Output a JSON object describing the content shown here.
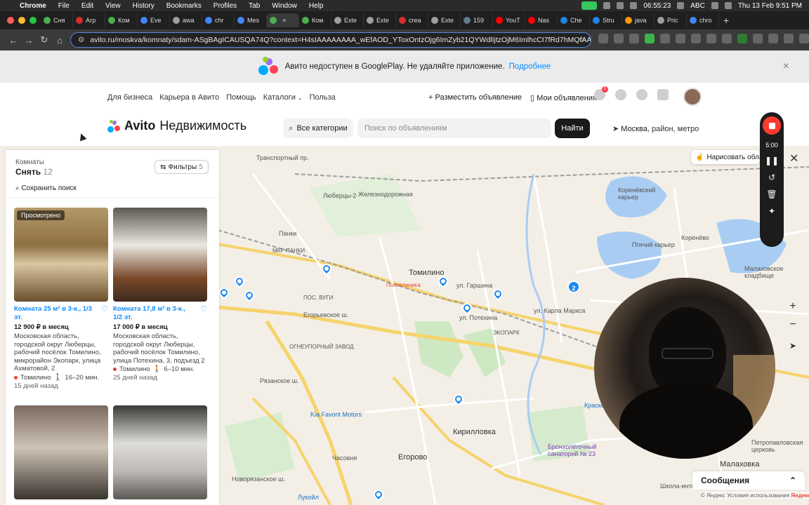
{
  "menubar": {
    "app": "Chrome",
    "items": [
      "File",
      "Edit",
      "View",
      "History",
      "Bookmarks",
      "Profiles",
      "Tab",
      "Window",
      "Help"
    ],
    "clock_timer": "06:55:23",
    "input_source": "ABC",
    "datetime": "Thu 13 Feb  9:51 PM"
  },
  "tabs": [
    {
      "label": "Сня",
      "color": "#4caf50"
    },
    {
      "label": "Агр",
      "color": "#d32f2f"
    },
    {
      "label": "Ком",
      "color": "#4caf50"
    },
    {
      "label": "Eve",
      "color": "#4285f4"
    },
    {
      "label": "awa",
      "color": "#9e9e9e"
    },
    {
      "label": "chr",
      "color": "#4285f4"
    },
    {
      "label": "Mes",
      "color": "#4285f4"
    },
    {
      "label": "",
      "color": "#4caf50",
      "active": true
    },
    {
      "label": "Ком",
      "color": "#4caf50"
    },
    {
      "label": "Exte",
      "color": "#9e9e9e"
    },
    {
      "label": "Exte",
      "color": "#9e9e9e"
    },
    {
      "label": "crea",
      "color": "#d32f2f"
    },
    {
      "label": "Exte",
      "color": "#9e9e9e"
    },
    {
      "label": "159",
      "color": "#607d8b"
    },
    {
      "label": "YouT",
      "color": "#ff0000"
    },
    {
      "label": "Nas",
      "color": "#ff0000"
    },
    {
      "label": "Che",
      "color": "#1e88e5"
    },
    {
      "label": "Stru",
      "color": "#1e88e5"
    },
    {
      "label": "java",
      "color": "#ff9800"
    },
    {
      "label": "Pric",
      "color": "#9e9e9e"
    },
    {
      "label": "chro",
      "color": "#4285f4"
    }
  ],
  "address": {
    "url": "avito.ru/moskva/komnaty/sdam-ASgBAgICAUSQA74Q?context=H4sIAAAAAAAA_wEfAOD_YToxOntzOjg6ImZyb21QYWdlIjtzOjM6ImlhcCI7fRd7hMQfAAAA&f=AS..."
  },
  "banner": {
    "text": "Авито недоступен в GooglePlay. Не удаляйте приложение.",
    "link": "Подробнее",
    "close": "×"
  },
  "topnav": {
    "links": [
      "Для бизнеса",
      "Карьера в Авито",
      "Помощь",
      "Каталоги",
      "Польза"
    ],
    "post_ad": "Разместить объявление",
    "my_ads": "Мои объявления",
    "fav_badge": "1"
  },
  "header": {
    "brand": "Avito",
    "section": "Недвижимость",
    "categories": "Все категории",
    "search_placeholder": "Поиск по объявлениям",
    "find": "Найти",
    "location": "Москва",
    "location_rest": ", район, метро"
  },
  "listing": {
    "crumb": "Комнаты",
    "title": "Снять",
    "count": "12",
    "filters": "Фильтры",
    "filters_count": "5",
    "save_search": "Сохранить поиск",
    "cards": [
      {
        "tag": "Просмотрено",
        "title": "Комната 25 м² в 3-к., 1/3 эт.",
        "price": "12 900 ₽ в месяц",
        "address": "Московская область, городской округ Люберцы, рабочий посёлок Томилино, микрорайон Экопарк, улица Ахматовой, 2",
        "metro": "Томилино",
        "walk": "16–20 мин.",
        "ago": "15 дней назад"
      },
      {
        "tag": "",
        "title": "Комната 17,8 м² в 3-к., 1/2 эт.",
        "price": "17 000 ₽ в месяц",
        "address": "Московская область, городской округ Люберцы, рабочий посёлок Томилино, улица Потехина, 3, подъезд 2",
        "metro": "Томилино",
        "walk": "6–10 мин.",
        "ago": "25 дней назад"
      }
    ]
  },
  "map": {
    "draw_area": "Нарисовать область",
    "messages": "Сообщения",
    "attribution": "© Яндекс Условия использования",
    "yandex": "Яндекс",
    "cluster_count": "2",
    "labels": [
      "Транспортный пр.",
      "Люберцы-2",
      "Железнодорожная",
      "Панки",
      "МКР ПАНКИ",
      "Томилино",
      "Поликлиника",
      "ул. Гаршина",
      "Егорьевское ш.",
      "ПОС. ВУГИ",
      "ЭКОПАРК",
      "ОГНЕУПОРНЫЙ ЗАВОД",
      "Кирилловка",
      "Егорово",
      "Часовня",
      "Kia Favorit Motors",
      "Бронхолёгочный санаторий № 23",
      "Малаховка",
      "Коренёвский карьер",
      "Пгичий карьер",
      "Коренёво",
      "Малаховское кладбище",
      "ул. Карла Маркса",
      "Рязанское ш.",
      "Новорязанское ш.",
      "ул. Потехина",
      "Лукойл",
      "Петропавловская церковь",
      "Школа-интернат",
      "Краско"
    ]
  },
  "recorder": {
    "time": "5:00"
  }
}
